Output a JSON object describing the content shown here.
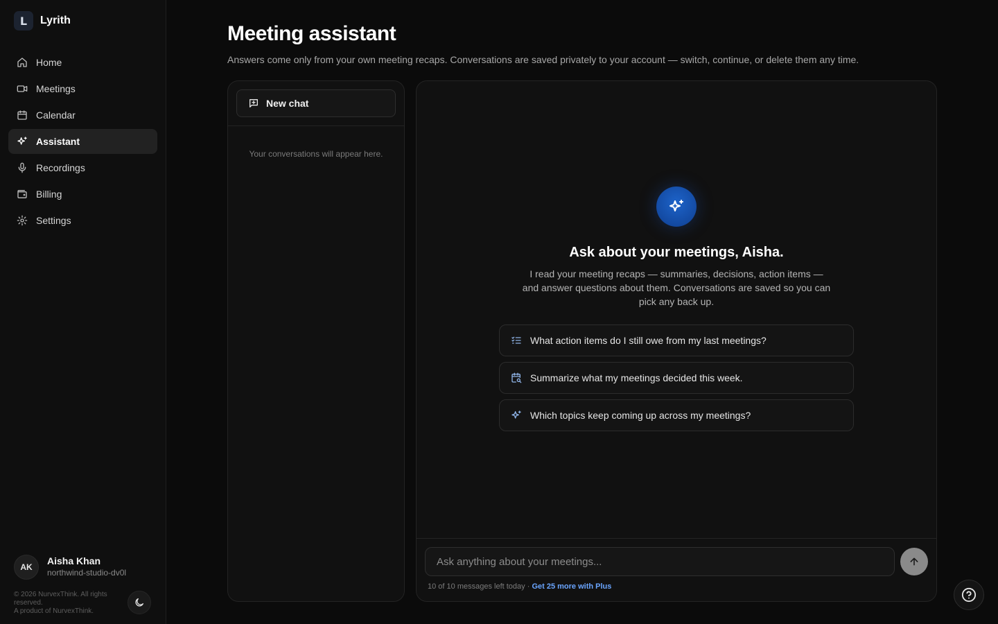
{
  "brand": {
    "logo_letter": "L",
    "name": "Lyrith"
  },
  "sidebar": {
    "items": [
      {
        "label": "Home",
        "icon": "home-icon"
      },
      {
        "label": "Meetings",
        "icon": "video-icon"
      },
      {
        "label": "Calendar",
        "icon": "calendar-icon"
      },
      {
        "label": "Assistant",
        "icon": "sparkles-icon",
        "active": true
      },
      {
        "label": "Recordings",
        "icon": "microphone-icon"
      },
      {
        "label": "Billing",
        "icon": "wallet-icon"
      },
      {
        "label": "Settings",
        "icon": "gear-icon"
      }
    ]
  },
  "user": {
    "initials": "AK",
    "name": "Aisha Khan",
    "workspace": "northwind-studio-dv0l"
  },
  "footer": {
    "copyright": "© 2026 NurvexThink. All rights reserved.",
    "product": "A product of NurvexThink."
  },
  "header": {
    "title": "Meeting assistant",
    "subtitle": "Answers come only from your own meeting recaps. Conversations are saved privately to your account — switch, continue, or delete them any time."
  },
  "conversations": {
    "new_chat_label": "New chat",
    "empty_text": "Your conversations will appear here."
  },
  "chat": {
    "hero_title": "Ask about your meetings, Aisha.",
    "hero_description": "I read your meeting recaps — summaries, decisions, action items — and answer questions about them. Conversations are saved so you can pick any back up.",
    "suggestions": [
      {
        "label": "What action items do I still owe from my last meetings?",
        "icon": "checklist-icon"
      },
      {
        "label": "Summarize what my meetings decided this week.",
        "icon": "calendar-search-icon"
      },
      {
        "label": "Which topics keep coming up across my meetings?",
        "icon": "sparkles-icon"
      }
    ],
    "input_placeholder": "Ask anything about your meetings...",
    "quota_text": "10 of 10 messages left today ·",
    "upgrade_link": "Get 25 more with Plus"
  },
  "colors": {
    "background": "#0b0b0b",
    "panel": "#111111",
    "accent": "#1d63c9",
    "link": "#6aa5ff"
  }
}
